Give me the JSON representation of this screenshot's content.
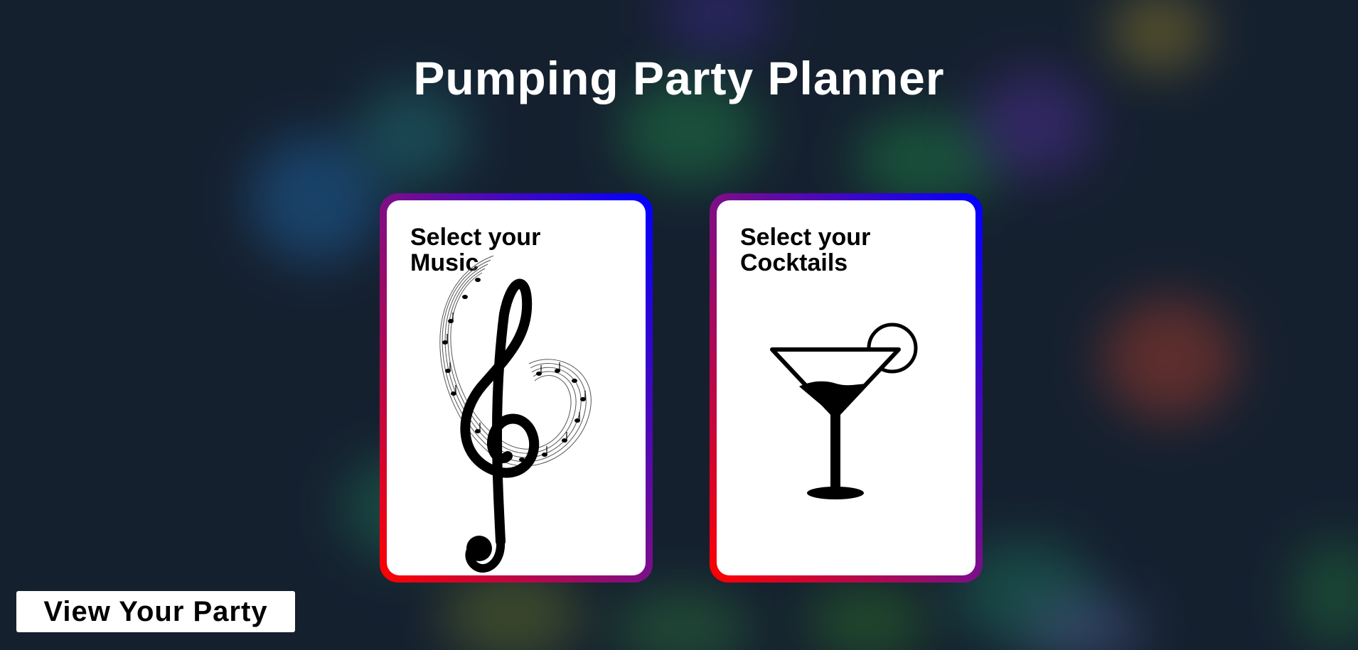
{
  "page": {
    "title": "Pumping Party Planner"
  },
  "cards": [
    {
      "title_line1": "Select your",
      "title_line2": "Music",
      "icon": "treble-clef-icon"
    },
    {
      "title_line1": "Select your",
      "title_line2": "Cocktails",
      "icon": "cocktail-glass-icon"
    }
  ],
  "footer": {
    "view_party_label": "View Your Party"
  },
  "colors": {
    "background": "#15202f",
    "card_border_start": "#ff0000",
    "card_border_mid": "#7d0e88",
    "card_border_end": "#0000ff",
    "card_fill": "#ffffff",
    "title_text": "#ffffff"
  }
}
